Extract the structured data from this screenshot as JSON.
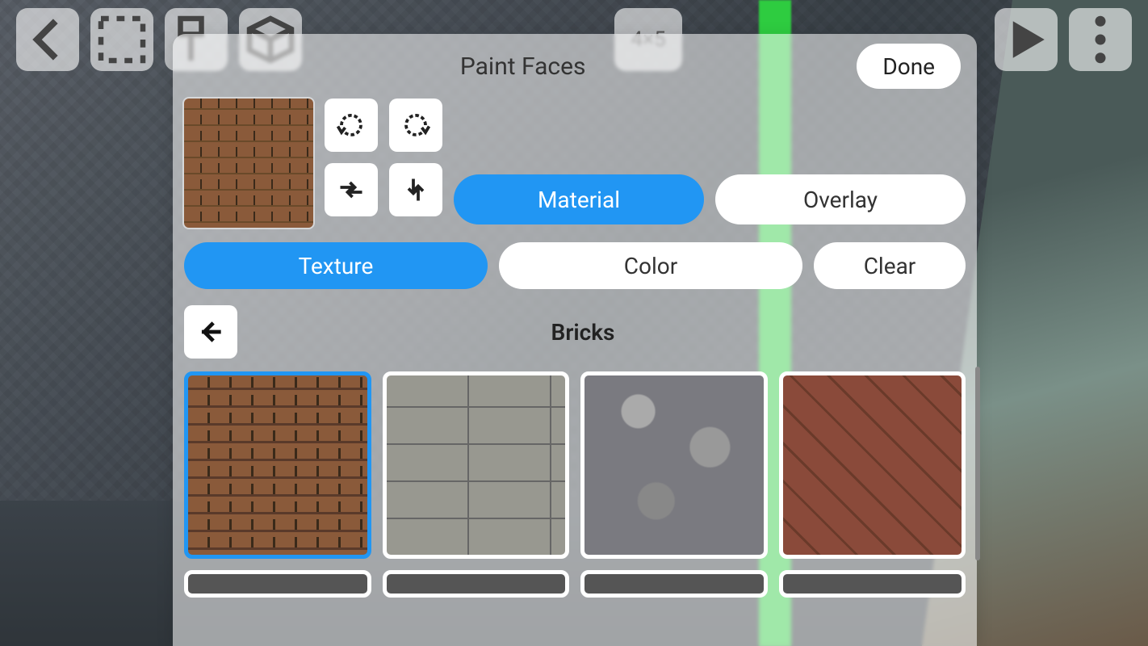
{
  "toolbar": {
    "back_icon": "arrow-left",
    "items": [
      "select-icon",
      "extrude-icon",
      "cube-icon"
    ],
    "grid_label": "4×5",
    "play_icon": "play",
    "menu_icon": "more-vert"
  },
  "dialog": {
    "title": "Paint Faces",
    "done_label": "Done",
    "preview_texture": "brick-red",
    "transform_buttons": [
      "rotate-ccw",
      "rotate-cw",
      "flip-horizontal",
      "flip-vertical"
    ],
    "mode_tabs": {
      "material_label": "Material",
      "overlay_label": "Overlay",
      "active": "material"
    },
    "action_tabs": {
      "texture_label": "Texture",
      "color_label": "Color",
      "clear_label": "Clear",
      "active": "texture"
    },
    "category": {
      "back_icon": "arrow-left",
      "title": "Bricks"
    },
    "textures": [
      {
        "name": "brick-red",
        "selected": true
      },
      {
        "name": "block-gray",
        "selected": false
      },
      {
        "name": "stone",
        "selected": false
      },
      {
        "name": "brick-dark",
        "selected": false
      }
    ]
  }
}
